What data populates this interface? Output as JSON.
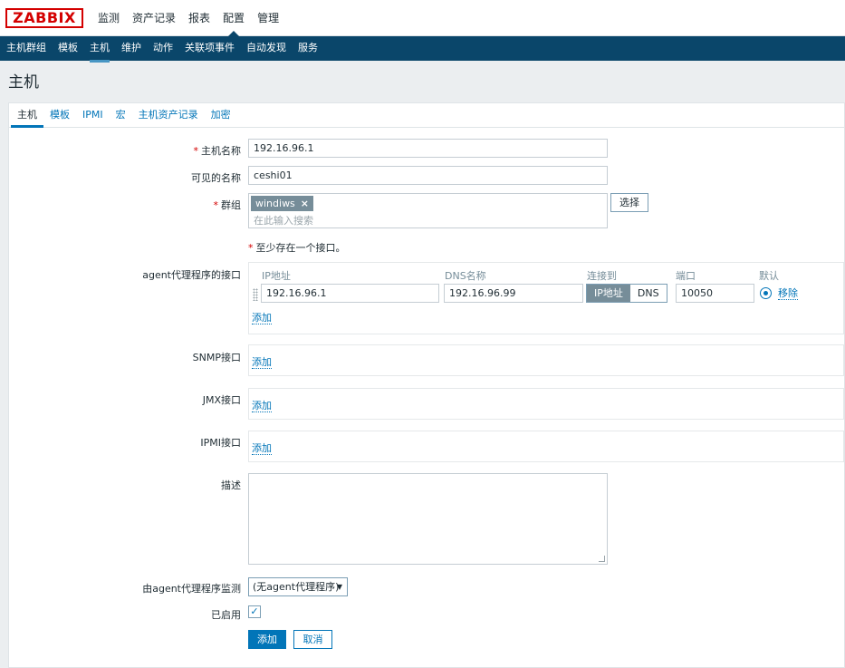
{
  "brand": {
    "logo_text": "ZABBIX",
    "accent": "#0275b8",
    "nav_bg": "#0a466a",
    "logo_color": "#d40000"
  },
  "topnav": [
    "监测",
    "资产记录",
    "报表",
    "配置",
    "管理"
  ],
  "subnav": [
    "主机群组",
    "模板",
    "主机",
    "维护",
    "动作",
    "关联项事件",
    "自动发现",
    "服务"
  ],
  "page": {
    "title": "主机"
  },
  "tabs": [
    "主机",
    "模板",
    "IPMI",
    "宏",
    "主机资产记录",
    "加密"
  ],
  "form": {
    "host_name_label": "主机名称",
    "host_name_value": "192.16.96.1",
    "visible_name_label": "可见的名称",
    "visible_name_value": "ceshi01",
    "groups_label": "群组",
    "group_chip": "windiws",
    "group_chip_remove": "×",
    "groups_placeholder": "在此输入搜索",
    "select_button": "选择",
    "required_mark": "*",
    "note": "至少存在一个接口。",
    "agent_iface_label": "agent代理程序的接口",
    "col_ip": "IP地址",
    "col_dns": "DNS名称",
    "col_connect": "连接到",
    "col_port": "端口",
    "col_default": "默认",
    "agent_ip": "192.16.96.1",
    "agent_dns": "192.16.96.99",
    "connect_ip": "IP地址",
    "connect_dns": "DNS",
    "agent_port": "10050",
    "remove_link": "移除",
    "add_link": "添加",
    "snmp_label": "SNMP接口",
    "jmx_label": "JMX接口",
    "ipmi_label": "IPMI接口",
    "desc_label": "描述",
    "proxy_label": "由agent代理程序监测",
    "proxy_value": "(无agent代理程序)",
    "enabled_label": "已启用",
    "enabled_check": "✓",
    "submit_button": "添加",
    "cancel_button": "取消"
  }
}
